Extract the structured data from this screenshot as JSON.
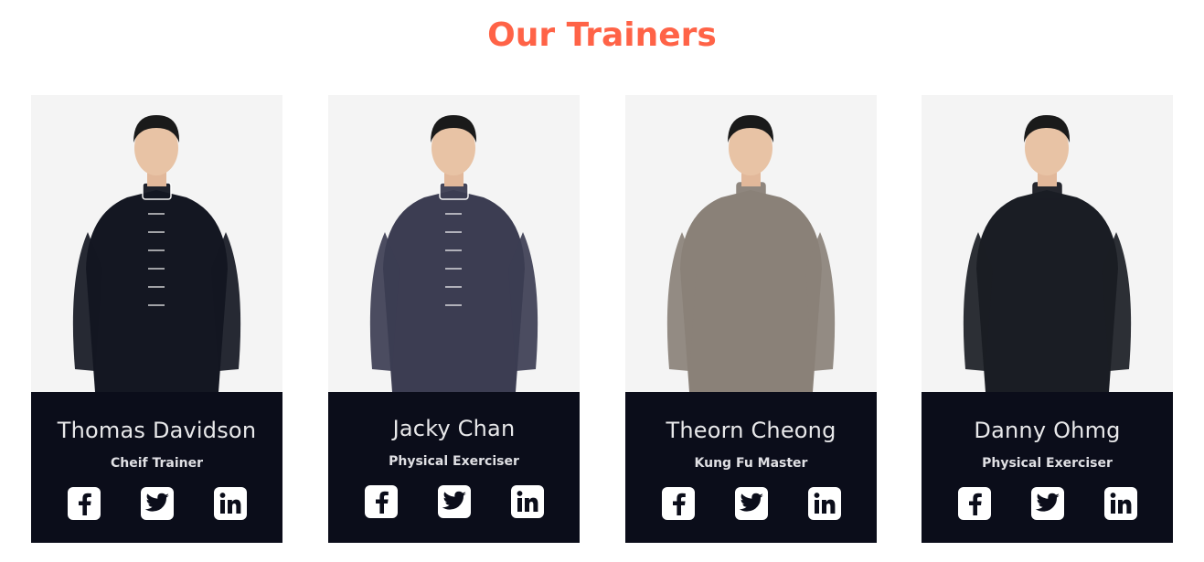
{
  "section": {
    "title": "Our Trainers"
  },
  "trainers": [
    {
      "name": "Thomas Davidson",
      "role": "Cheif Trainer",
      "outfit_color": "#141722",
      "trim_color": "#ffffff"
    },
    {
      "name": "Jacky Chan",
      "role": "Physical Exerciser",
      "outfit_color": "#3c3d52",
      "trim_color": "#ffffff"
    },
    {
      "name": "Theorn Cheong",
      "role": "Kung Fu Master",
      "outfit_color": "#8a8178",
      "trim_color": "#8a8178"
    },
    {
      "name": "Danny Ohmg",
      "role": "Physical Exerciser",
      "outfit_color": "#1a1d24",
      "trim_color": "#1a1d24"
    }
  ],
  "social": [
    "facebook-icon",
    "twitter-icon",
    "linkedin-icon"
  ],
  "colors": {
    "accent": "#ff6347",
    "card_dark": "#0b0d1a",
    "photo_bg": "#f4f4f4"
  }
}
